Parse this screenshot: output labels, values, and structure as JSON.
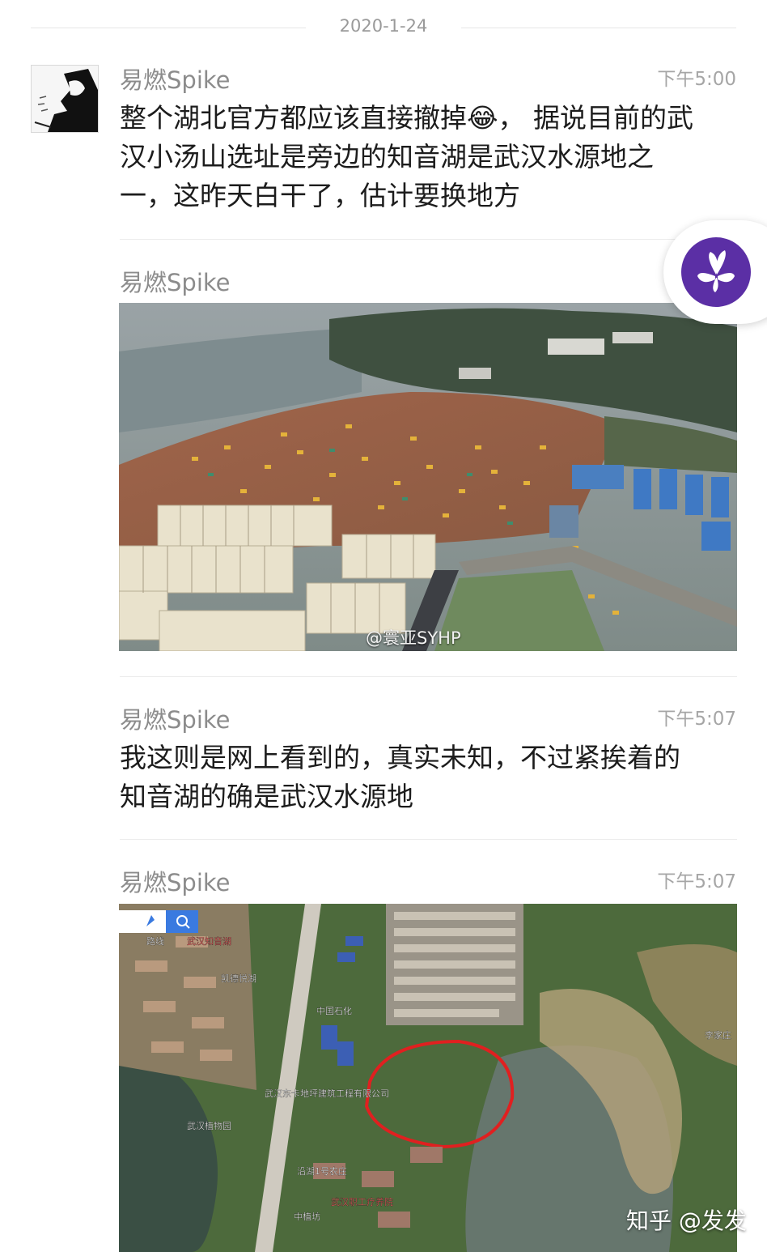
{
  "date_divider": "2020-1-24",
  "messages": [
    {
      "sender": "易燃Spike",
      "time": "下午5:00",
      "lines": [
        "整个湖北官方都应该直接撤掉😂，  据说目前的武",
        "汉小汤山选址是旁边的知音湖是武汉水源地之",
        "一，这昨天白干了，估计要换地方"
      ]
    },
    {
      "sender": "易燃Spike",
      "time": "",
      "photo_watermark": "@寰亚SYHP"
    },
    {
      "sender": "易燃Spike",
      "time": "下午5:07",
      "lines": [
        "我这则是网上看到的，真实未知，不过紧挨着的",
        "知音湖的确是武汉水源地"
      ]
    },
    {
      "sender": "易燃Spike",
      "time": "下午5:07"
    }
  ],
  "map_labels": {
    "route": "路线",
    "lake": "武汉知音湖",
    "kaide": "凯德悦湖",
    "sinopec": "中国石化",
    "company": "武汉东卡地坪建筑工程有限公司",
    "road": "沿湖1号农庄",
    "sanatorium": "武汉职工疗养院",
    "garden": "武汉植物园",
    "plant": "中植坊",
    "far": "李家庄"
  },
  "watermark": "知乎 @发发",
  "colors": {
    "accent": "#5b2fa5",
    "circle": "#e02020"
  }
}
